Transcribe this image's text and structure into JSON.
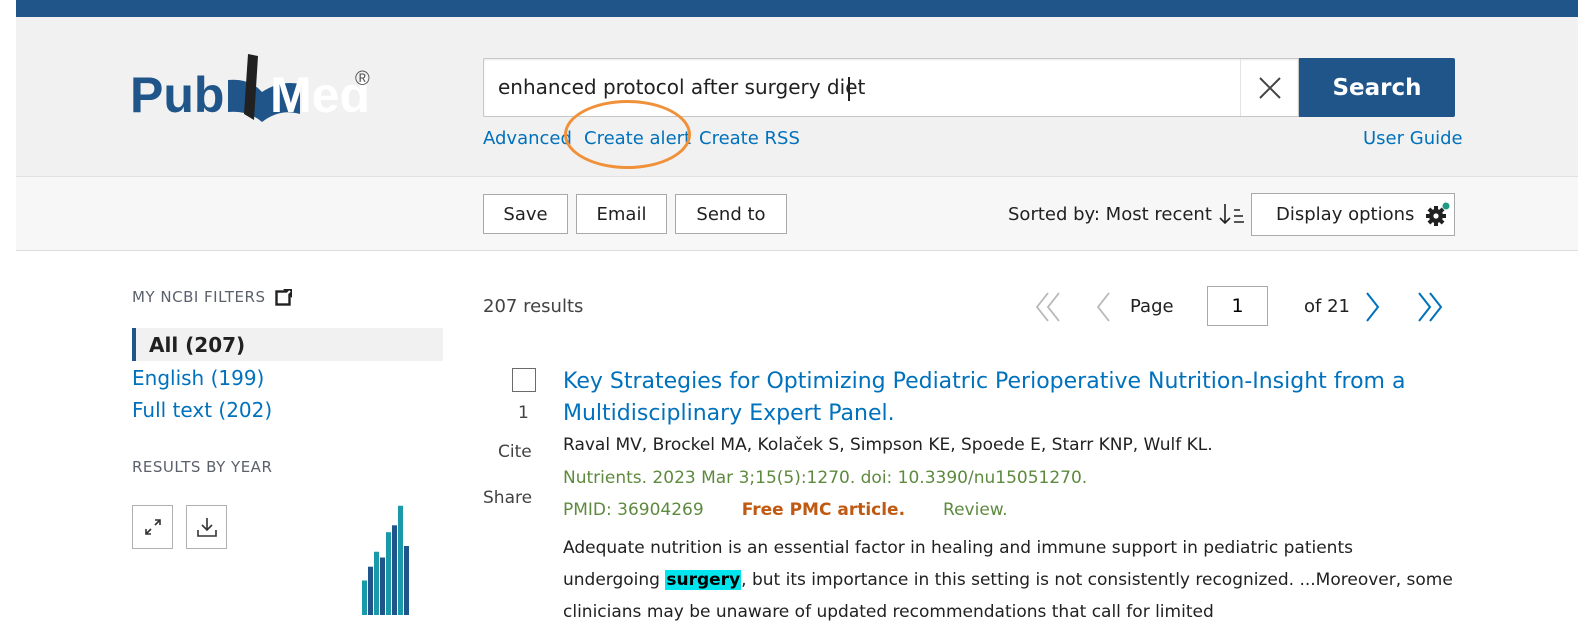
{
  "brand": {
    "logo_text_left": "Pub",
    "logo_text_right": "Med",
    "registered": "®"
  },
  "search": {
    "query": "enhanced protocol after surgery diet",
    "button_label": "Search"
  },
  "search_links": {
    "advanced": "Advanced",
    "create_alert": "Create alert",
    "create_rss": "Create RSS",
    "user_guide": "User Guide"
  },
  "toolbar": {
    "save": "Save",
    "email": "Email",
    "send_to": "Send to",
    "sorted_by": "Sorted by: Most recent",
    "display_options": "Display options"
  },
  "filters": {
    "heading": "MY NCBI FILTERS",
    "all": "All (207)",
    "english": "English (199)",
    "full_text": "Full text (202)",
    "results_by_year": "RESULTS BY YEAR",
    "year_bars": [
      0.3,
      0.42,
      0.55,
      0.5,
      0.72,
      0.78,
      0.95,
      0.6
    ]
  },
  "results": {
    "count_text": "207 results",
    "page_label": "Page",
    "page_value": "1",
    "of_pages": "of 21"
  },
  "article": {
    "number": "1",
    "cite": "Cite",
    "share": "Share",
    "title": "Key Strategies for Optimizing Pediatric Perioperative Nutrition-Insight from a Multidisciplinary Expert Panel.",
    "authors": "Raval MV, Brockel MA, Kolaček S, Simpson KE, Spoede E, Starr KNP, Wulf KL.",
    "journal": "Nutrients. 2023 Mar 3;15(5):1270. doi: 10.3390/nu15051270.",
    "pmid": "PMID: 36904269",
    "free_pmc": "Free PMC article.",
    "review": "Review.",
    "snippet_start": "Adequate nutrition is an essential factor in healing and immune support in pediatric patients undergoing ",
    "snippet_highlight": "surgery",
    "snippet_end": ", but its importance in this setting is not consistently recognized. ...Moreover, some clinicians may be unaware of updated recommendations that call for limited"
  },
  "colors": {
    "brand_blue": "#20558a",
    "link_blue": "#0071bc",
    "alert_ring": "#f0913a",
    "highlight": "#00e5ee",
    "free_pmc": "#c05a12",
    "journal_green": "#5e8a3f"
  }
}
